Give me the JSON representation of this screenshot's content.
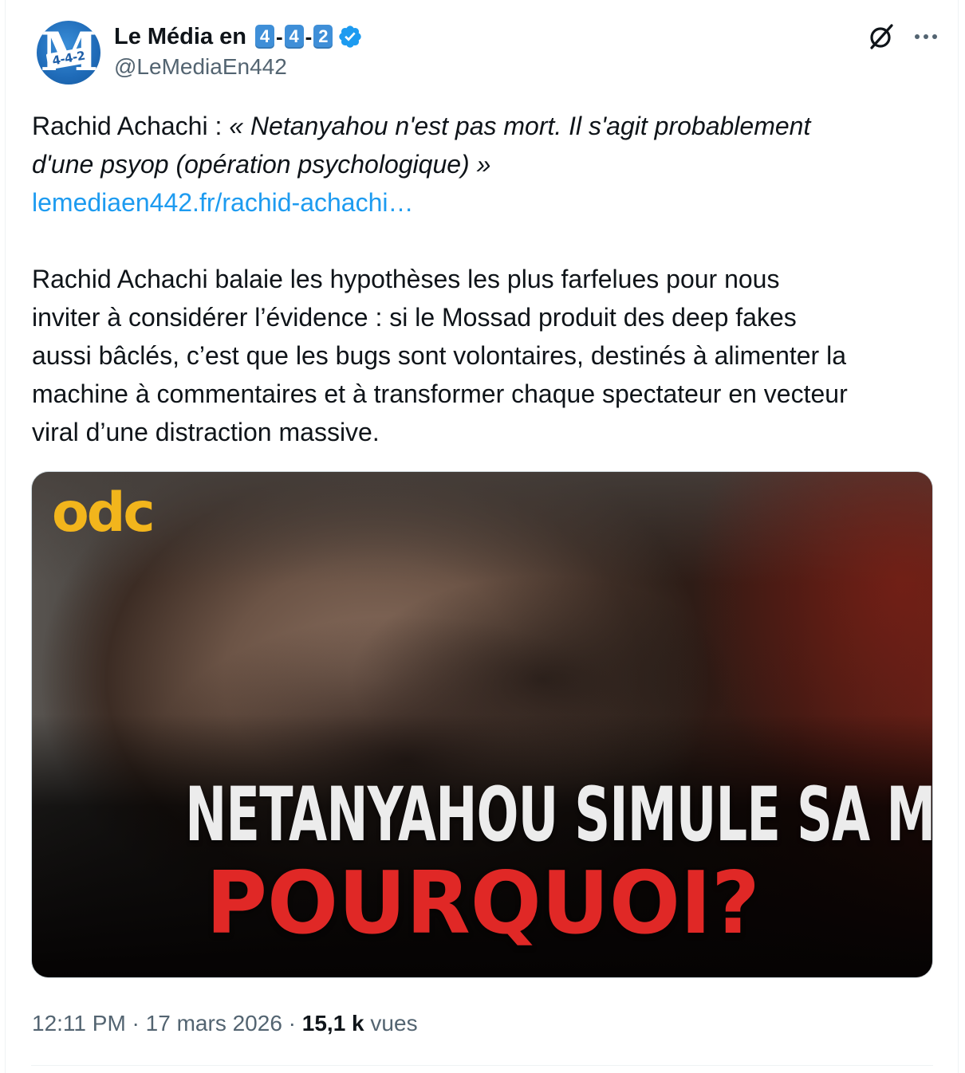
{
  "author": {
    "display_name_prefix": "Le Média en",
    "keycaps": [
      "4",
      "4",
      "2"
    ],
    "separator": "-",
    "handle": "@LeMediaEn442",
    "verified": true,
    "avatar_text": "M",
    "avatar_badge": "4-4-2",
    "avatar_color": "#1f6bb8"
  },
  "header_icons": {
    "grok": "grok-icon",
    "more": "more-icon"
  },
  "post": {
    "lead_speaker": "Rachid Achachi : ",
    "quote_line1": "« Netanyahou n'est pas mort. Il s'agit probablement",
    "quote_line2": "d'une psyop (opération psychologique) »",
    "link_text": "lemediaen442.fr/rachid-achachi…",
    "body_lines": [
      "Rachid Achachi balaie les hypothèses les plus farfelues pour nous",
      "inviter à considérer l’évidence : si le Mossad produit des deep fakes",
      "aussi bâclés, c’est que les bugs sont volontaires, destinés à alimenter  la",
      "machine à commentaires et à transformer chaque spectateur en vecteur",
      "viral d’une distraction massive."
    ]
  },
  "media": {
    "logo": "odc",
    "headline": "NETANYAHOU SIMULE SA MORT",
    "subheadline": "POURQUOI?",
    "logo_color": "#f2b51c",
    "subheadline_color": "#e02826"
  },
  "meta": {
    "time": "12:11 PM",
    "sep": " · ",
    "date": "17 mars 2026",
    "views_count": "15,1 k",
    "views_label": " vues"
  },
  "colors": {
    "link": "#1d9bf0",
    "secondary_text": "#536471",
    "verified": "#1d9bf0"
  }
}
